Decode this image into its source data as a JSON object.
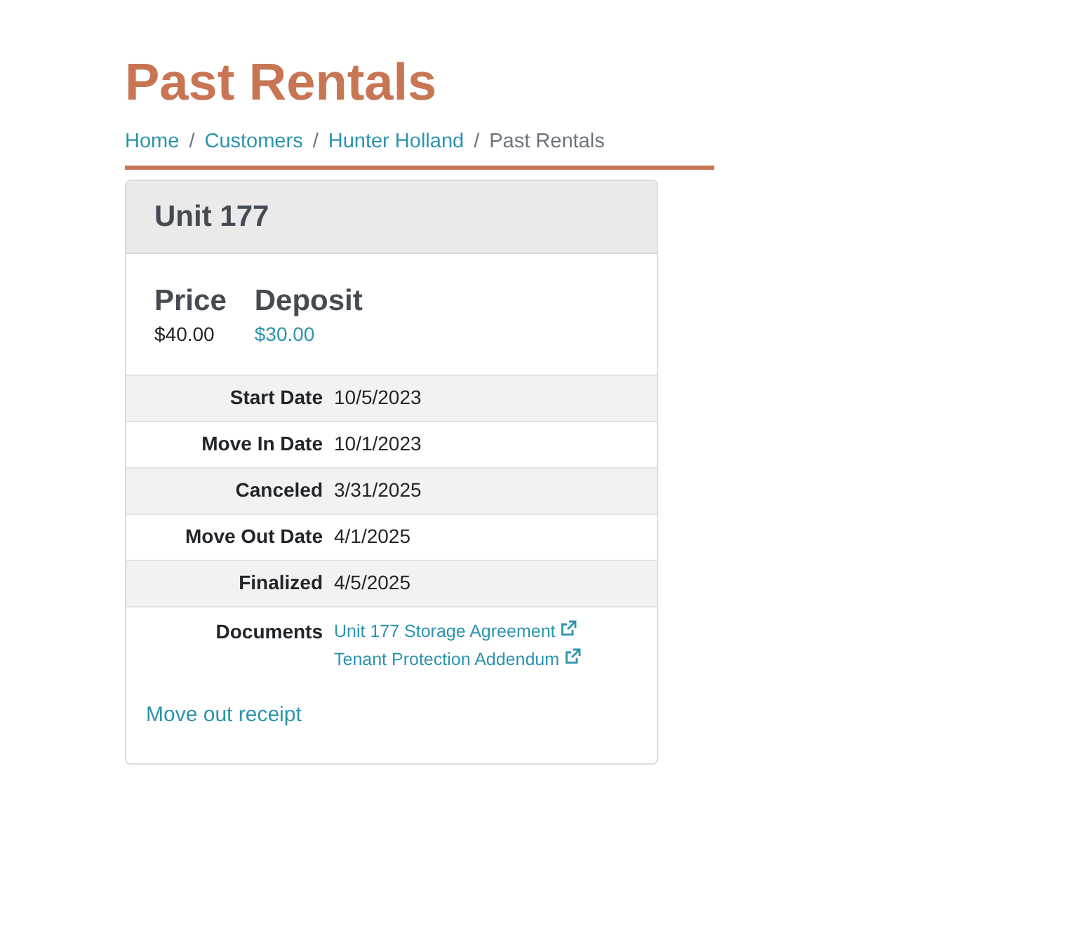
{
  "title": "Past Rentals",
  "breadcrumb": {
    "separator": "/",
    "items": [
      {
        "label": "Home",
        "current": false
      },
      {
        "label": "Customers",
        "current": false
      },
      {
        "label": "Hunter Holland",
        "current": false
      },
      {
        "label": "Past Rentals",
        "current": true
      }
    ]
  },
  "card": {
    "title": "Unit 177",
    "summary": [
      {
        "label": "Price",
        "value": "$40.00",
        "link": false
      },
      {
        "label": "Deposit",
        "value": "$30.00",
        "link": true
      }
    ],
    "details": [
      {
        "label": "Start Date",
        "value": "10/5/2023"
      },
      {
        "label": "Move In Date",
        "value": "10/1/2023"
      },
      {
        "label": "Canceled",
        "value": "3/31/2025"
      },
      {
        "label": "Move Out Date",
        "value": "4/1/2025"
      },
      {
        "label": "Finalized",
        "value": "4/5/2025"
      }
    ],
    "documents": {
      "label": "Documents",
      "links": [
        "Unit 177 Storage Agreement",
        "Tenant Protection Addendum"
      ]
    },
    "footer_link": "Move out receipt"
  }
}
